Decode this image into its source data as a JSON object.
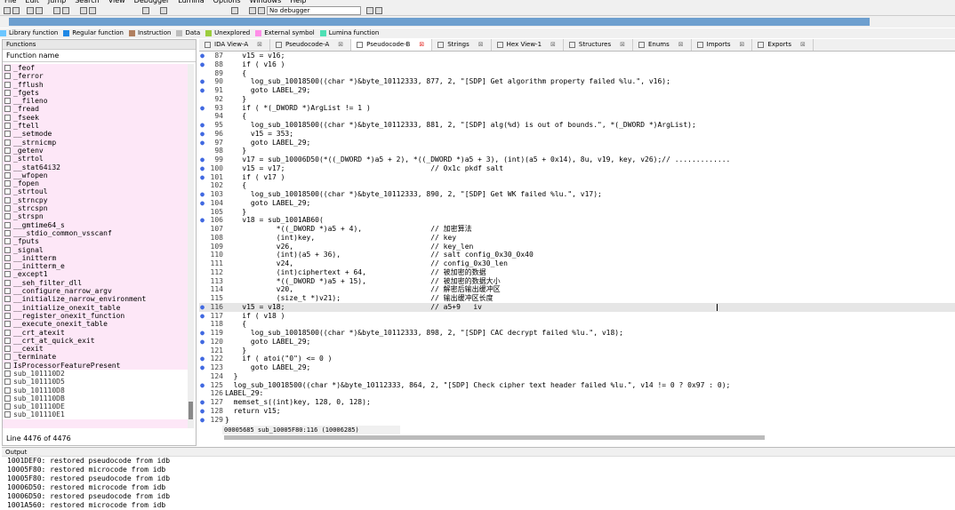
{
  "menu": [
    "File",
    "Edit",
    "Jump",
    "Search",
    "View",
    "Debugger",
    "Lumina",
    "Options",
    "Windows",
    "Help"
  ],
  "toolbar": {
    "debugger": "No debugger"
  },
  "legend": [
    {
      "label": "Library function",
      "color": "#6cc6ff"
    },
    {
      "label": "Regular function",
      "color": "#1f88e5"
    },
    {
      "label": "Instruction",
      "color": "#b07f5f"
    },
    {
      "label": "Data",
      "color": "#bdbdbd"
    },
    {
      "label": "Unexplored",
      "color": "#9ccd3e"
    },
    {
      "label": "External symbol",
      "color": "#ff8ee8"
    },
    {
      "label": "Lumina function",
      "color": "#4fe0b4"
    }
  ],
  "functions_panel": {
    "title": "Functions",
    "column": "Function name",
    "items": [
      "_feof",
      "_ferror",
      "_fflush",
      "_fgets",
      "__fileno",
      "_fread",
      "_fseek",
      "_ftell",
      "__setmode",
      "__strnicmp",
      "_getenv",
      "_strtol",
      "__stat64i32",
      "__wfopen",
      "_fopen",
      "_strtoul",
      "_strncpy",
      "_strcspn",
      "_strspn",
      "__gmtime64_s",
      "___stdio_common_vsscanf",
      "_fputs",
      "_signal",
      "__initterm",
      "__initterm_e",
      "_except1",
      "__seh_filter_dll",
      "__configure_narrow_argv",
      "__initialize_narrow_environment",
      "__initialize_onexit_table",
      "__register_onexit_function",
      "__execute_onexit_table",
      "__crt_atexit",
      "__crt_at_quick_exit",
      "__cexit",
      "_terminate",
      "IsProcessorFeaturePresent",
      "sub_101110D2",
      "sub_101110D5",
      "sub_101110D8",
      "sub_101110DB",
      "sub_101110DE",
      "sub_101110E1"
    ],
    "status": "Line 4476 of 4476"
  },
  "tabs": [
    {
      "label": "IDA View-A",
      "active": false
    },
    {
      "label": "Pseudocode-A",
      "active": false
    },
    {
      "label": "Pseudocode-B",
      "active": true
    },
    {
      "label": "Strings",
      "active": false
    },
    {
      "label": "Hex View-1",
      "active": false
    },
    {
      "label": "Structures",
      "active": false
    },
    {
      "label": "Enums",
      "active": false
    },
    {
      "label": "Imports",
      "active": false
    },
    {
      "label": "Exports",
      "active": false
    }
  ],
  "code": [
    {
      "n": "87",
      "dot": true,
      "t": "    v15 = v16;"
    },
    {
      "n": "88",
      "dot": true,
      "t": "    if ( v16 )"
    },
    {
      "n": "89",
      "dot": false,
      "t": "    {"
    },
    {
      "n": "90",
      "dot": true,
      "t": "      log_sub_10018500((char *)&byte_10112333, 877, 2, \"[SDP] Get algorithm property failed %lu.\", v16);"
    },
    {
      "n": "91",
      "dot": true,
      "t": "      goto LABEL_29;"
    },
    {
      "n": "92",
      "dot": false,
      "t": "    }"
    },
    {
      "n": "93",
      "dot": true,
      "t": "    if ( *(_DWORD *)ArgList != 1 )"
    },
    {
      "n": "94",
      "dot": false,
      "t": "    {"
    },
    {
      "n": "95",
      "dot": true,
      "t": "      log_sub_10018500((char *)&byte_10112333, 881, 2, \"[SDP] alg(%d) is out of bounds.\", *(_DWORD *)ArgList);"
    },
    {
      "n": "96",
      "dot": true,
      "t": "      v15 = 353;"
    },
    {
      "n": "97",
      "dot": true,
      "t": "      goto LABEL_29;"
    },
    {
      "n": "98",
      "dot": false,
      "t": "    }"
    },
    {
      "n": "99",
      "dot": true,
      "t": "    v17 = sub_10006D50(*((_DWORD *)a5 + 2), *((_DWORD *)a5 + 3), (int)(a5 + 0x14), 8u, v19, key, v26);// ............."
    },
    {
      "n": "100",
      "dot": true,
      "t": "    v15 = v17;                                  // 0x1c pkdf salt"
    },
    {
      "n": "101",
      "dot": true,
      "t": "    if ( v17 )"
    },
    {
      "n": "102",
      "dot": false,
      "t": "    {"
    },
    {
      "n": "103",
      "dot": true,
      "t": "      log_sub_10018500((char *)&byte_10112333, 890, 2, \"[SDP] Get WK failed %lu.\", v17);"
    },
    {
      "n": "104",
      "dot": true,
      "t": "      goto LABEL_29;"
    },
    {
      "n": "105",
      "dot": false,
      "t": "    }"
    },
    {
      "n": "106",
      "dot": true,
      "t": "    v18 = sub_1001AB60("
    },
    {
      "n": "107",
      "dot": false,
      "t": "            *((_DWORD *)a5 + 4),                // 加密算法"
    },
    {
      "n": "108",
      "dot": false,
      "t": "            (int)key,                           // key"
    },
    {
      "n": "109",
      "dot": false,
      "t": "            v26,                                // key_len"
    },
    {
      "n": "110",
      "dot": false,
      "t": "            (int)(a5 + 36),                     // salt config_0x30_0x40"
    },
    {
      "n": "111",
      "dot": false,
      "t": "            v24,                                // config_0x30_len"
    },
    {
      "n": "112",
      "dot": false,
      "t": "            (int)ciphertext + 64,               // 被加密的数据"
    },
    {
      "n": "113",
      "dot": false,
      "t": "            *((_DWORD *)a5 + 15),               // 被加密的数据大小"
    },
    {
      "n": "114",
      "dot": false,
      "t": "            v20,                                // 解密后输出缓冲区"
    },
    {
      "n": "115",
      "dot": false,
      "t": "            (size_t *)v21);                     // 输出缓冲区长度"
    },
    {
      "n": "116",
      "dot": true,
      "t": "    v15 = v18;                                  // a5+9   iv",
      "hl": true
    },
    {
      "n": "117",
      "dot": true,
      "t": "    if ( v18 )"
    },
    {
      "n": "118",
      "dot": false,
      "t": "    {"
    },
    {
      "n": "119",
      "dot": true,
      "t": "      log_sub_10018500((char *)&byte_10112333, 898, 2, \"[SDP] CAC decrypt failed %lu.\", v18);"
    },
    {
      "n": "120",
      "dot": true,
      "t": "      goto LABEL_29;"
    },
    {
      "n": "121",
      "dot": false,
      "t": "    }"
    },
    {
      "n": "122",
      "dot": true,
      "t": "    if ( atoi(\"0\") <= 0 )"
    },
    {
      "n": "123",
      "dot": true,
      "t": "      goto LABEL_29;"
    },
    {
      "n": "124",
      "dot": false,
      "t": "  }"
    },
    {
      "n": "125",
      "dot": true,
      "t": "  log_sub_10018500((char *)&byte_10112333, 864, 2, \"[SDP] Check cipher text header failed %lu.\", v14 != 0 ? 0x97 : 0);"
    },
    {
      "n": "126",
      "dot": false,
      "t": "LABEL_29:"
    },
    {
      "n": "127",
      "dot": true,
      "t": "  memset_s((int)key, 128, 0, 128);"
    },
    {
      "n": "128",
      "dot": true,
      "t": "  return v15;"
    },
    {
      "n": "129",
      "dot": true,
      "t": "}"
    }
  ],
  "code_status": "00005685 sub_10005F80:116 (10006285)",
  "output": {
    "title": "Output",
    "lines": [
      "1001DEF0: restored pseudocode from idb",
      "10005F80: restored microcode from idb",
      "10005F80: restored pseudocode from idb",
      "10006D50: restored microcode from idb",
      "10006D50: restored pseudocode from idb",
      "1001A560: restored microcode from idb"
    ]
  }
}
